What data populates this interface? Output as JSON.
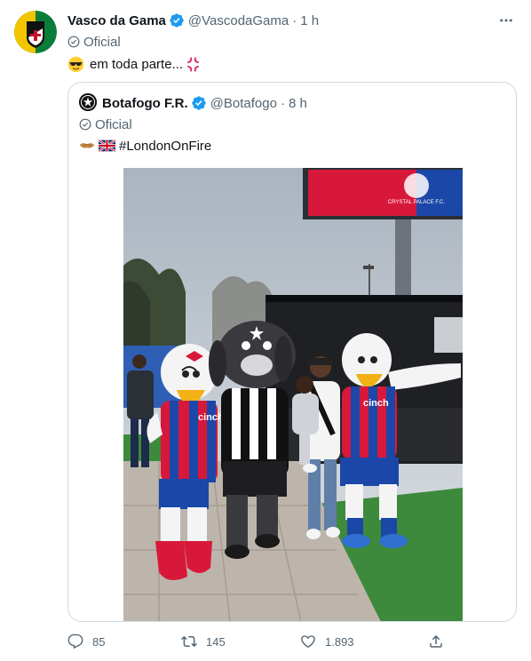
{
  "tweet": {
    "author_name": "Vasco da Gama",
    "author_handle": "@VascodaGama",
    "time": "1 h",
    "label": "Oficial",
    "text": "em toda parte...",
    "emojis": [
      "sunglasses-face-emoji",
      "anger-symbol-emoji"
    ]
  },
  "quote": {
    "author_name": "Botafogo F.R.",
    "author_handle": "@Botafogo",
    "time": "8 h",
    "label": "Oficial",
    "text": "#LondonOnFire",
    "emojis": [
      "handshake-emoji",
      "uk-flag-emoji"
    ],
    "photo": {
      "scoreboard_text": "CRYSTAL PALACE F.C.",
      "jersey_text": "cinch"
    }
  },
  "actions": {
    "replies": "85",
    "retweets": "145",
    "likes": "1.893"
  },
  "colors": {
    "text": "#0f1419",
    "secondary": "#536471",
    "verified": "#1d9bf0",
    "border": "#cfd9de",
    "palace_red": "#d8183a",
    "palace_blue": "#1b47a8"
  }
}
